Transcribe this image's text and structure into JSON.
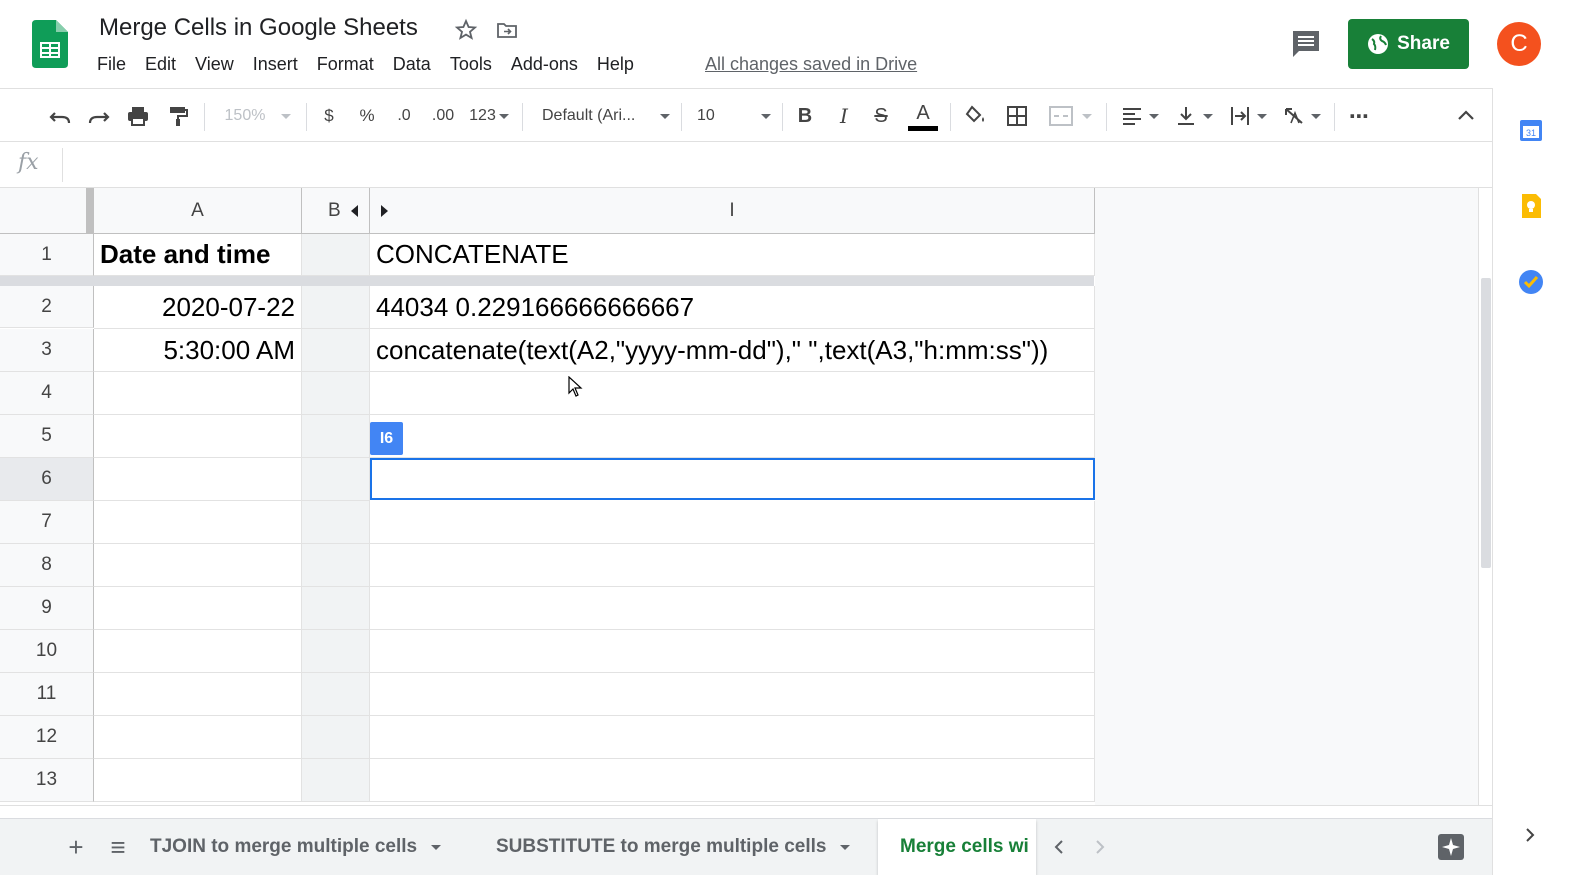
{
  "header": {
    "title": "Merge Cells in Google Sheets",
    "menu": [
      "File",
      "Edit",
      "View",
      "Insert",
      "Format",
      "Data",
      "Tools",
      "Add-ons",
      "Help"
    ],
    "saved_status": "All changes saved in Drive",
    "share_label": "Share",
    "avatar_letter": "C",
    "colors": {
      "share": "#188038",
      "avatar": "#f4511e",
      "brand": "#0f9d58"
    }
  },
  "toolbar": {
    "zoom": "150%",
    "currency": "$",
    "percent": "%",
    "decrease_decimals": ".0",
    "increase_decimals": ".00",
    "more_formats": "123",
    "font": "Default (Ari...",
    "font_size": "10",
    "bold": "B",
    "italic": "I",
    "strikethrough": "S",
    "text_color": "A",
    "more": "⋯"
  },
  "formula_bar": {
    "fx": "fx",
    "value": ""
  },
  "grid": {
    "columns": [
      "A",
      "B",
      "I"
    ],
    "rows": [
      "1",
      "2",
      "3",
      "4",
      "5",
      "6",
      "7",
      "8",
      "9",
      "10",
      "11",
      "12",
      "13"
    ],
    "cells": {
      "A1": "Date and time",
      "A2": "2020-07-22",
      "A3": "5:30:00 AM",
      "I1": "CONCATENATE",
      "I2": "44034 0.229166666666667",
      "I3": "concatenate(text(A2,\"yyyy-mm-dd\"),\" \",text(A3,\"h:mm:ss\"))"
    },
    "selected_cell": "I6"
  },
  "sheets": {
    "tabs": [
      "TJOIN to merge multiple cells",
      "SUBSTITUTE to merge multiple cells",
      "Merge cells wi"
    ],
    "active_index": 2,
    "add_label": "+",
    "list_label": "≡"
  }
}
